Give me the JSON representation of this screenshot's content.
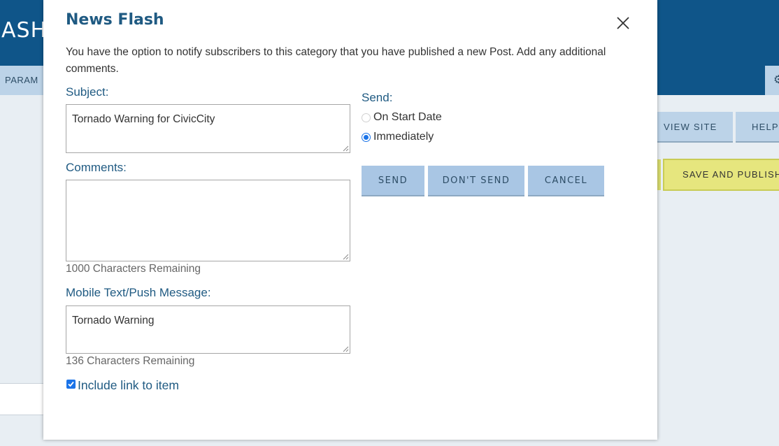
{
  "background": {
    "header_title": "ASH",
    "tab_label": "PARAM",
    "buttons": {
      "view_site": "VIEW SITE",
      "help": "HELP",
      "save_and_publish": "SAVE AND PUBLISH"
    }
  },
  "modal": {
    "title": "News Flash",
    "intro": "You have the option to notify subscribers to this category that you have published a new Post. Add any additional comments.",
    "subject": {
      "label": "Subject:",
      "value": "Tornado Warning for CivicCity"
    },
    "comments": {
      "label": "Comments:",
      "value": "",
      "remaining": "1000 Characters Remaining"
    },
    "mobile": {
      "label": "Mobile Text/Push Message:",
      "value": "Tornado Warning",
      "remaining": "136 Characters Remaining"
    },
    "include_link": {
      "label": "Include link to item",
      "checked": true
    },
    "send": {
      "label": "Send:",
      "options": [
        {
          "label": "On Start Date",
          "selected": false
        },
        {
          "label": "Immediately",
          "selected": true
        }
      ]
    },
    "actions": {
      "send": "SEND",
      "dont_send": "DON'T SEND",
      "cancel": "CANCEL"
    },
    "colors": {
      "title": "#1f5a82",
      "header_bg": "#0f5589",
      "button_bg": "#a9c6e4",
      "publish_bg": "#e6e67e",
      "accent": "#1a73e8"
    }
  }
}
